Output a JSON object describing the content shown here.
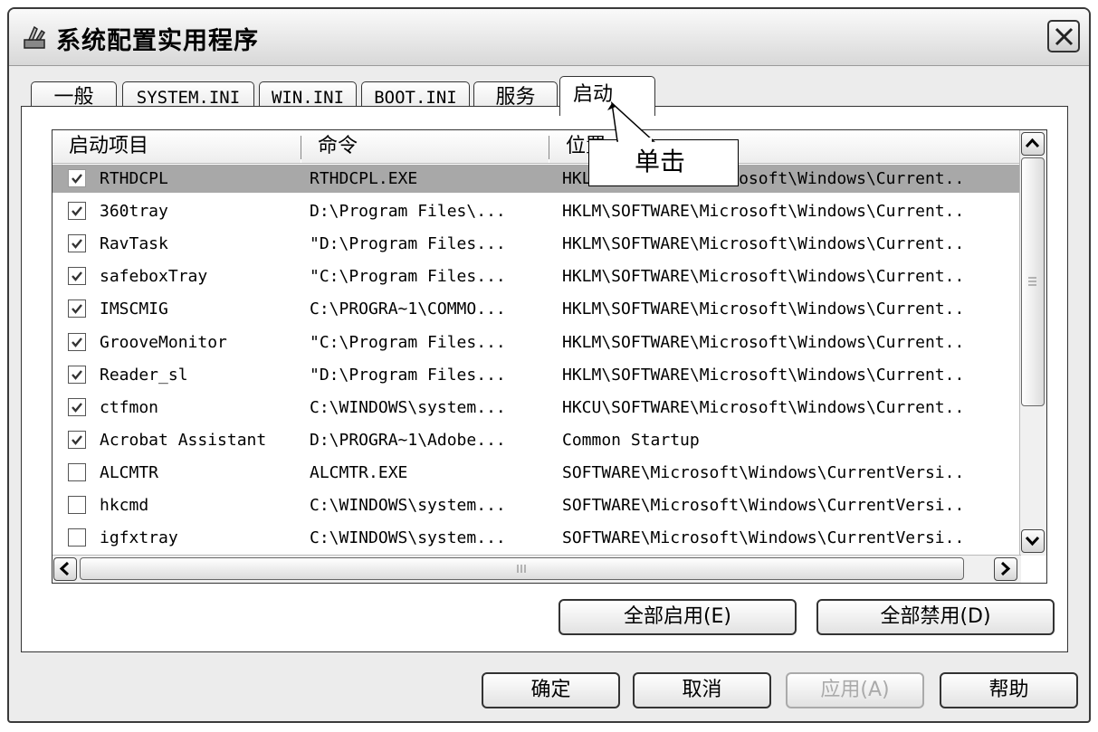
{
  "window": {
    "title": "系统配置实用程序",
    "close_label": "×"
  },
  "tabs": [
    {
      "label": "一般"
    },
    {
      "label": "SYSTEM.INI"
    },
    {
      "label": "WIN.INI"
    },
    {
      "label": "BOOT.INI"
    },
    {
      "label": "服务"
    },
    {
      "label": "启动",
      "active": true
    }
  ],
  "list": {
    "columns": [
      "启动项目",
      "命令",
      "位置"
    ],
    "rows": [
      {
        "checked": true,
        "selected": true,
        "name": "RTHDCPL",
        "command": "RTHDCPL.EXE",
        "location": "HKLM\\SOFTWARE\\Microsoft\\Windows\\Current..",
        "location_visible": "HK",
        "location_tail": "crosoft\\Windows\\Current.."
      },
      {
        "checked": true,
        "name": "360tray",
        "command": "D:\\Program Files\\...",
        "location": "HKLM\\SOFTWARE\\Microsoft\\Windows\\Current.."
      },
      {
        "checked": true,
        "name": "RavTask",
        "command": "\"D:\\Program Files...",
        "location": "HKLM\\SOFTWARE\\Microsoft\\Windows\\Current.."
      },
      {
        "checked": true,
        "name": "safeboxTray",
        "command": "\"C:\\Program Files...",
        "location": "HKLM\\SOFTWARE\\Microsoft\\Windows\\Current.."
      },
      {
        "checked": true,
        "name": "IMSCMIG",
        "command": "C:\\PROGRA~1\\COMMO...",
        "location": "HKLM\\SOFTWARE\\Microsoft\\Windows\\Current.."
      },
      {
        "checked": true,
        "name": "GrooveMonitor",
        "command": "\"C:\\Program Files...",
        "location": "HKLM\\SOFTWARE\\Microsoft\\Windows\\Current.."
      },
      {
        "checked": true,
        "name": "Reader_sl",
        "command": "\"D:\\Program Files...",
        "location": "HKLM\\SOFTWARE\\Microsoft\\Windows\\Current.."
      },
      {
        "checked": true,
        "name": "ctfmon",
        "command": "C:\\WINDOWS\\system...",
        "location": "HKCU\\SOFTWARE\\Microsoft\\Windows\\Current.."
      },
      {
        "checked": true,
        "name": "Acrobat Assistant",
        "command": "D:\\PROGRA~1\\Adobe...",
        "location": "Common Startup"
      },
      {
        "checked": false,
        "name": "ALCMTR",
        "command": "ALCMTR.EXE",
        "location": "SOFTWARE\\Microsoft\\Windows\\CurrentVersi.."
      },
      {
        "checked": false,
        "name": "hkcmd",
        "command": "C:\\WINDOWS\\system...",
        "location": "SOFTWARE\\Microsoft\\Windows\\CurrentVersi.."
      },
      {
        "checked": false,
        "name": "igfxtray",
        "command": "C:\\WINDOWS\\system...",
        "location": "SOFTWARE\\Microsoft\\Windows\\CurrentVersi.."
      }
    ]
  },
  "actions": {
    "enable_all": "全部启用(E)",
    "disable_all": "全部禁用(D)"
  },
  "dialog_buttons": {
    "ok": "确定",
    "cancel": "取消",
    "apply": "应用(A)",
    "help": "帮助"
  },
  "callout": {
    "text": "单击"
  },
  "icons": {
    "window": "msconfig-app-icon",
    "close": "close-icon",
    "check": "checkmark-icon",
    "scroll_up": "scroll-up-icon",
    "scroll_down": "scroll-down-icon",
    "scroll_left": "scroll-left-icon",
    "scroll_right": "scroll-right-icon"
  }
}
